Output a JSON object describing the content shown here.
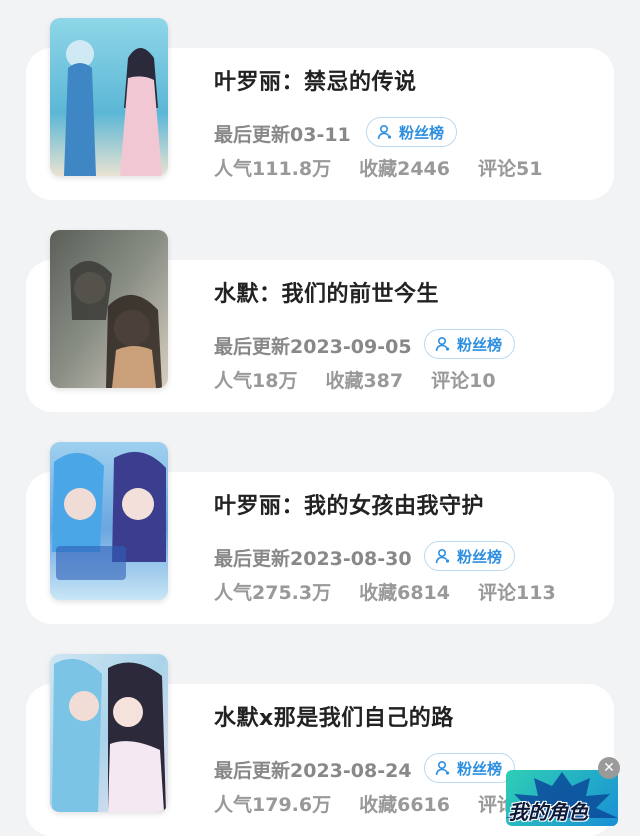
{
  "works": [
    {
      "title": "叶罗丽：禁忌的传说",
      "updated": "最后更新03-11",
      "fans_label": "粉丝榜",
      "popularity": "人气111.8万",
      "favorites": "收藏2446",
      "comments": "评论51"
    },
    {
      "title": "水默：我们的前世今生",
      "updated": "最后更新2023-09-05",
      "fans_label": "粉丝榜",
      "popularity": "人气18万",
      "favorites": "收藏387",
      "comments": "评论10"
    },
    {
      "title": "叶罗丽：我的女孩由我守护",
      "updated": "最后更新2023-08-30",
      "fans_label": "粉丝榜",
      "popularity": "人气275.3万",
      "favorites": "收藏6814",
      "comments": "评论113"
    },
    {
      "title": "水默x那是我们自己的路",
      "updated": "最后更新2023-08-24",
      "fans_label": "粉丝榜",
      "popularity": "人气179.6万",
      "favorites": "收藏6616",
      "comments": "评论"
    }
  ],
  "promo": {
    "label": "我的角色",
    "close_icon": "close-icon"
  },
  "colors": {
    "accent": "#2e8fe0",
    "title": "#222222",
    "muted": "#888888",
    "background": "#f2f3f5"
  }
}
